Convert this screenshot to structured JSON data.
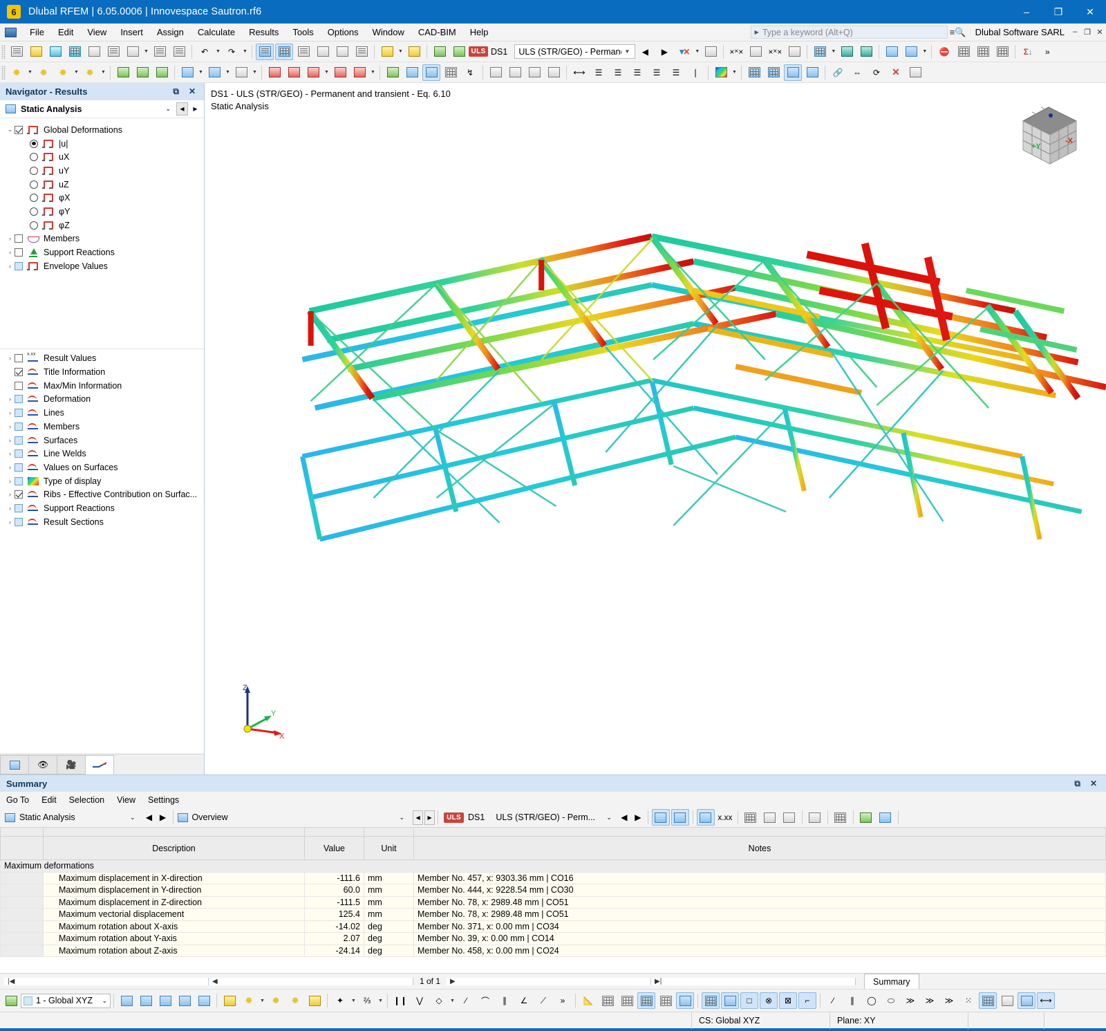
{
  "titlebar": {
    "app_icon": "rfem-logo-icon",
    "title": "Dlubal RFEM | 6.05.0006 | Innovespace Sautron.rf6",
    "minimize": "–",
    "maximize": "❐",
    "close": "✕"
  },
  "menubar": {
    "items": [
      "File",
      "Edit",
      "View",
      "Insert",
      "Assign",
      "Calculate",
      "Results",
      "Tools",
      "Options",
      "Window",
      "CAD-BIM",
      "Help"
    ],
    "search_placeholder": "Type a keyword (Alt+Q)",
    "company": "Dlubal Software SARL",
    "minimize": "–",
    "restore": "❐",
    "close": "✕"
  },
  "toolbar_main": {
    "load_case_badge": "ULS",
    "design_situation": "DS1",
    "combination": "ULS (STR/GEO) - Permane...",
    "overflow": "»"
  },
  "navigator": {
    "title": "Navigator - Results",
    "float_icon": "restore-icon",
    "close_icon": "close-icon",
    "selector_value": "Static Analysis",
    "tree_top": [
      {
        "label": "Global Deformations",
        "type": "check",
        "checked": true,
        "expanded": true,
        "icon": "frame-icon",
        "indent": 0
      },
      {
        "label": "|u|",
        "type": "radio",
        "selected": true,
        "icon": "frame-icon",
        "indent": 1
      },
      {
        "label": "uX",
        "type": "radio",
        "selected": false,
        "icon": "frame-icon",
        "indent": 1
      },
      {
        "label": "uY",
        "type": "radio",
        "selected": false,
        "icon": "frame-icon",
        "indent": 1
      },
      {
        "label": "uZ",
        "type": "radio",
        "selected": false,
        "icon": "frame-icon",
        "indent": 1
      },
      {
        "label": "φX",
        "type": "radio",
        "selected": false,
        "icon": "frame-icon",
        "indent": 1
      },
      {
        "label": "φY",
        "type": "radio",
        "selected": false,
        "icon": "frame-icon",
        "indent": 1
      },
      {
        "label": "φZ",
        "type": "radio",
        "selected": false,
        "icon": "frame-icon",
        "indent": 1
      },
      {
        "label": "Members",
        "type": "check",
        "checked": false,
        "expandable": true,
        "icon": "member-diagram-icon",
        "indent": 0
      },
      {
        "label": "Support Reactions",
        "type": "check",
        "checked": false,
        "expandable": true,
        "icon": "support-icon",
        "indent": 0
      },
      {
        "label": "Envelope Values",
        "type": "check",
        "checked": false,
        "partial": true,
        "expandable": true,
        "icon": "frame-icon",
        "indent": 0
      }
    ],
    "tree_bottom": [
      {
        "label": "Result Values",
        "type": "check",
        "checked": false,
        "expandable": true,
        "icon": "result-values-icon"
      },
      {
        "label": "Title Information",
        "type": "check",
        "checked": true,
        "expandable": false,
        "icon": "display-icon"
      },
      {
        "label": "Max/Min Information",
        "type": "check",
        "checked": false,
        "expandable": false,
        "icon": "display-icon"
      },
      {
        "label": "Deformation",
        "type": "check",
        "checked": false,
        "partial": true,
        "expandable": true,
        "icon": "display-icon"
      },
      {
        "label": "Lines",
        "type": "check",
        "checked": false,
        "partial": true,
        "expandable": true,
        "icon": "display-icon"
      },
      {
        "label": "Members",
        "type": "check",
        "checked": false,
        "partial": true,
        "expandable": true,
        "icon": "display-icon"
      },
      {
        "label": "Surfaces",
        "type": "check",
        "checked": false,
        "partial": true,
        "expandable": true,
        "icon": "display-icon"
      },
      {
        "label": "Line Welds",
        "type": "check",
        "checked": false,
        "partial": true,
        "expandable": true,
        "icon": "display-icon"
      },
      {
        "label": "Values on Surfaces",
        "type": "check",
        "checked": false,
        "partial": true,
        "expandable": true,
        "icon": "display-icon"
      },
      {
        "label": "Type of display",
        "type": "check",
        "checked": false,
        "partial": true,
        "expandable": true,
        "icon": "color-scale-icon"
      },
      {
        "label": "Ribs - Effective Contribution on Surfac...",
        "type": "check",
        "checked": true,
        "expandable": true,
        "icon": "display-icon"
      },
      {
        "label": "Support Reactions",
        "type": "check",
        "checked": false,
        "partial": true,
        "expandable": true,
        "icon": "display-icon"
      },
      {
        "label": "Result Sections",
        "type": "check",
        "checked": false,
        "partial": true,
        "expandable": true,
        "icon": "display-icon"
      }
    ],
    "tabs": [
      "model-tab-icon",
      "visibility-tab-icon",
      "video-tab-icon",
      "results-tab-icon"
    ]
  },
  "viewport": {
    "title_line1": "DS1 - ULS (STR/GEO) - Permanent and transient - Eq. 6.10",
    "title_line2": "Static Analysis",
    "nav_cube_labels": {
      "front": "+Y",
      "side": "-X"
    },
    "axis_labels": {
      "x": "X",
      "y": "Y",
      "z": "Z"
    },
    "result_type": "|u| global deformation"
  },
  "summary": {
    "title": "Summary",
    "float_icon": "restore-icon",
    "close_icon": "close-icon",
    "menu": [
      "Go To",
      "Edit",
      "Selection",
      "View",
      "Settings"
    ],
    "analysis_selector": "Static Analysis",
    "view_selector": "Overview",
    "load_case_badge": "ULS",
    "design_situation": "DS1",
    "combination": "ULS (STR/GEO) - Perm...",
    "columns": [
      "",
      "Description",
      "Value",
      "Unit",
      "Notes"
    ],
    "group_row": "Maximum deformations",
    "rows": [
      {
        "description": "Maximum displacement in X-direction",
        "value": "-111.6",
        "unit": "mm",
        "notes": "Member No. 457, x: 9303.36 mm | CO16"
      },
      {
        "description": "Maximum displacement in Y-direction",
        "value": "60.0",
        "unit": "mm",
        "notes": "Member No. 444, x: 9228.54 mm | CO30"
      },
      {
        "description": "Maximum displacement in Z-direction",
        "value": "-111.5",
        "unit": "mm",
        "notes": "Member No. 78, x: 2989.48 mm | CO51"
      },
      {
        "description": "Maximum vectorial displacement",
        "value": "125.4",
        "unit": "mm",
        "notes": "Member No. 78, x: 2989.48 mm | CO51"
      },
      {
        "description": "Maximum rotation about X-axis",
        "value": "-14.02",
        "unit": "deg",
        "notes": "Member No. 371, x: 0.00 mm | CO34"
      },
      {
        "description": "Maximum rotation about Y-axis",
        "value": "2.07",
        "unit": "deg",
        "notes": "Member No. 39, x: 0.00 mm | CO14"
      },
      {
        "description": "Maximum rotation about Z-axis",
        "value": "-24.14",
        "unit": "deg",
        "notes": "Member No. 458, x: 0.00 mm | CO24"
      }
    ],
    "page_indicator": "1 of 1",
    "tab_label": "Summary"
  },
  "statusbar": {
    "coordinate_system": "1 - Global XYZ",
    "cs_label": "CS: Global XYZ",
    "plane_label": "Plane: XY"
  },
  "colors": {
    "accent": "#0a6cbe",
    "title_panel": "#d6e5f5",
    "uls_badge": "#c9443b",
    "row_highlight": "#fffdf0",
    "toolbar_bg": "#f3f3f3"
  }
}
